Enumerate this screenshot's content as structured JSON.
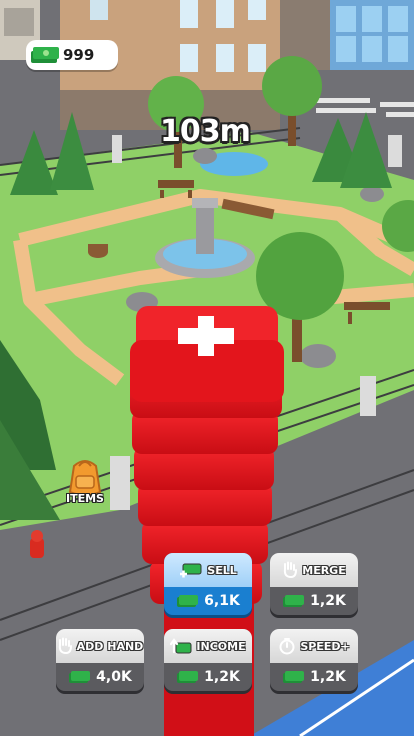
{
  "hud": {
    "cash": "999",
    "height": "103m",
    "items_label": "ITEMS"
  },
  "upgrades": {
    "sell": {
      "label": "SELL",
      "price": "6,1K",
      "icon": "sell-cash-icon"
    },
    "merge": {
      "label": "MERGE",
      "price": "1,2K",
      "icon": "hand-merge-icon"
    },
    "add_hand": {
      "label": "ADD HAND",
      "price": "4,0K",
      "icon": "hand-add-icon"
    },
    "income": {
      "label": "INCOME",
      "price": "1,2K",
      "icon": "income-arrow-icon"
    },
    "speed": {
      "label": "SPEED+",
      "price": "1,2K",
      "icon": "stopwatch-icon"
    }
  },
  "colors": {
    "stack_red": "#e8121b",
    "park_grass": "#8fd067",
    "path_sand": "#f0c08a",
    "active_button_blue": "#1a7fd0",
    "cash_green": "#2fb24a"
  }
}
